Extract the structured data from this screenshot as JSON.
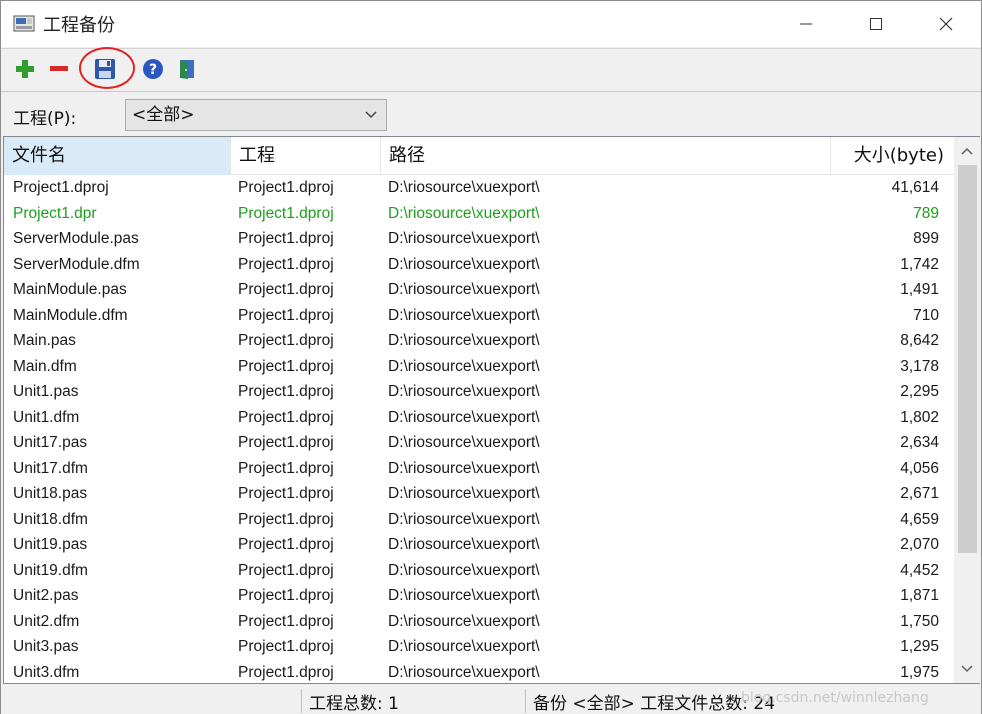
{
  "window": {
    "title": "工程备份",
    "controls": {
      "minimize": "—",
      "maximize": "☐",
      "close": "✕"
    }
  },
  "toolbar": {
    "buttons": [
      {
        "name": "add",
        "icon": "plus-icon"
      },
      {
        "name": "remove",
        "icon": "minus-icon"
      },
      {
        "name": "save",
        "icon": "floppy-disk-icon"
      },
      {
        "name": "help",
        "icon": "help-icon"
      },
      {
        "name": "exit",
        "icon": "exit-door-icon"
      }
    ]
  },
  "filter": {
    "label": "工程(P):",
    "selected": "<全部>"
  },
  "table": {
    "columns": [
      "文件名",
      "工程",
      "路径",
      "大小(byte)"
    ],
    "rows": [
      {
        "file": "Project1.dproj",
        "project": "Project1.dproj",
        "path": "D:\\riosource\\xuexport\\",
        "size": "41,614",
        "highlight": false
      },
      {
        "file": "Project1.dpr",
        "project": "Project1.dproj",
        "path": "D:\\riosource\\xuexport\\",
        "size": "789",
        "highlight": true
      },
      {
        "file": "ServerModule.pas",
        "project": "Project1.dproj",
        "path": "D:\\riosource\\xuexport\\",
        "size": "899",
        "highlight": false
      },
      {
        "file": "ServerModule.dfm",
        "project": "Project1.dproj",
        "path": "D:\\riosource\\xuexport\\",
        "size": "1,742",
        "highlight": false
      },
      {
        "file": "MainModule.pas",
        "project": "Project1.dproj",
        "path": "D:\\riosource\\xuexport\\",
        "size": "1,491",
        "highlight": false
      },
      {
        "file": "MainModule.dfm",
        "project": "Project1.dproj",
        "path": "D:\\riosource\\xuexport\\",
        "size": "710",
        "highlight": false
      },
      {
        "file": "Main.pas",
        "project": "Project1.dproj",
        "path": "D:\\riosource\\xuexport\\",
        "size": "8,642",
        "highlight": false
      },
      {
        "file": "Main.dfm",
        "project": "Project1.dproj",
        "path": "D:\\riosource\\xuexport\\",
        "size": "3,178",
        "highlight": false
      },
      {
        "file": "Unit1.pas",
        "project": "Project1.dproj",
        "path": "D:\\riosource\\xuexport\\",
        "size": "2,295",
        "highlight": false
      },
      {
        "file": "Unit1.dfm",
        "project": "Project1.dproj",
        "path": "D:\\riosource\\xuexport\\",
        "size": "1,802",
        "highlight": false
      },
      {
        "file": "Unit17.pas",
        "project": "Project1.dproj",
        "path": "D:\\riosource\\xuexport\\",
        "size": "2,634",
        "highlight": false
      },
      {
        "file": "Unit17.dfm",
        "project": "Project1.dproj",
        "path": "D:\\riosource\\xuexport\\",
        "size": "4,056",
        "highlight": false
      },
      {
        "file": "Unit18.pas",
        "project": "Project1.dproj",
        "path": "D:\\riosource\\xuexport\\",
        "size": "2,671",
        "highlight": false
      },
      {
        "file": "Unit18.dfm",
        "project": "Project1.dproj",
        "path": "D:\\riosource\\xuexport\\",
        "size": "4,659",
        "highlight": false
      },
      {
        "file": "Unit19.pas",
        "project": "Project1.dproj",
        "path": "D:\\riosource\\xuexport\\",
        "size": "2,070",
        "highlight": false
      },
      {
        "file": "Unit19.dfm",
        "project": "Project1.dproj",
        "path": "D:\\riosource\\xuexport\\",
        "size": "4,452",
        "highlight": false
      },
      {
        "file": "Unit2.pas",
        "project": "Project1.dproj",
        "path": "D:\\riosource\\xuexport\\",
        "size": "1,871",
        "highlight": false
      },
      {
        "file": "Unit2.dfm",
        "project": "Project1.dproj",
        "path": "D:\\riosource\\xuexport\\",
        "size": "1,750",
        "highlight": false
      },
      {
        "file": "Unit3.pas",
        "project": "Project1.dproj",
        "path": "D:\\riosource\\xuexport\\",
        "size": "1,295",
        "highlight": false
      },
      {
        "file": "Unit3.dfm",
        "project": "Project1.dproj",
        "path": "D:\\riosource\\xuexport\\",
        "size": "1,975",
        "highlight": false
      }
    ]
  },
  "status": {
    "project_count": "工程总数: 1",
    "backup_summary": "备份 <全部> 工程文件总数: 24",
    "watermark": "blog.csdn.net/winnlezhang"
  },
  "colors": {
    "highlight_row": "#1e9e1e",
    "header_active": "#d9ebf9",
    "annotation_circle": "#e02424"
  }
}
